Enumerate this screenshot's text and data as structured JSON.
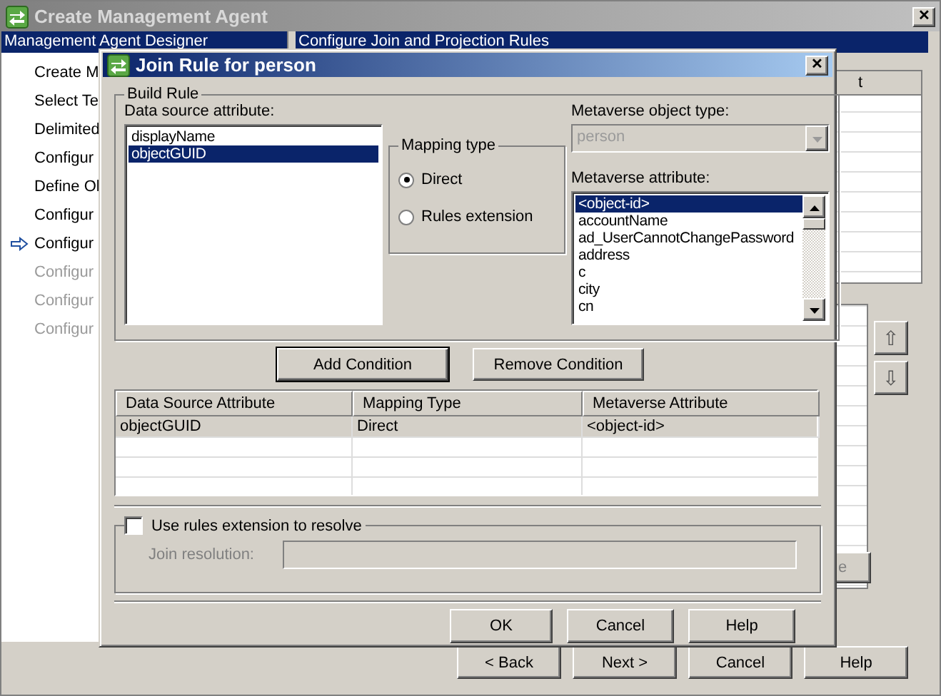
{
  "window": {
    "title": "Create Management Agent",
    "close": "✕"
  },
  "wizard": {
    "sidebar_header": "Management Agent Designer",
    "steps": [
      {
        "label": "Create M",
        "current": false,
        "disabled": false
      },
      {
        "label": "Select Te",
        "current": false,
        "disabled": false
      },
      {
        "label": "Delimited",
        "current": false,
        "disabled": false
      },
      {
        "label": "Configur",
        "current": false,
        "disabled": false
      },
      {
        "label": "Define Ol",
        "current": false,
        "disabled": false
      },
      {
        "label": "Configur",
        "current": false,
        "disabled": false
      },
      {
        "label": "Configur",
        "current": true,
        "disabled": false
      },
      {
        "label": "Configur",
        "current": false,
        "disabled": true
      },
      {
        "label": "Configur",
        "current": false,
        "disabled": true
      },
      {
        "label": "Configur",
        "current": false,
        "disabled": true
      }
    ],
    "page_header": "Configure Join and Projection Rules",
    "grid_column": "t",
    "partial_button": "e",
    "move_buttons": [
      "⇧",
      "⇩"
    ],
    "buttons": [
      "< Back",
      "Next >",
      "Cancel",
      "Help"
    ]
  },
  "dialog": {
    "title": "Join Rule for person",
    "close": "✕",
    "group_title": "Build Rule",
    "data_source_label": "Data source attribute:",
    "data_source_items": [
      {
        "label": "displayName",
        "selected": false
      },
      {
        "label": "objectGUID",
        "selected": true
      }
    ],
    "mapping_type": {
      "title": "Mapping type",
      "options": [
        {
          "label": "Direct",
          "selected": true
        },
        {
          "label": "Rules extension",
          "selected": false
        }
      ]
    },
    "object_type_label": "Metaverse object type:",
    "object_type": {
      "value": "person",
      "disabled": true
    },
    "attribute_label": "Metaverse attribute:",
    "attributes": [
      {
        "label": "<object-id>",
        "selected": true
      },
      {
        "label": "accountName",
        "selected": false
      },
      {
        "label": "ad_UserCannotChangePassword",
        "selected": false
      },
      {
        "label": "address",
        "selected": false
      },
      {
        "label": "c",
        "selected": false
      },
      {
        "label": "city",
        "selected": false
      },
      {
        "label": "cn",
        "selected": false
      }
    ],
    "condition_buttons": [
      "Add Condition",
      "Remove Condition"
    ],
    "table": {
      "columns": [
        "Data Source Attribute",
        "Mapping Type",
        "Metaverse Attribute"
      ],
      "rows": [
        {
          "cells": [
            "objectGUID",
            "Direct",
            "<object-id>"
          ],
          "selected": true
        }
      ]
    },
    "resolve": {
      "label": "Use rules extension to resolve",
      "checked": false
    },
    "join_resolution_label": "Join resolution:",
    "buttons": [
      "OK",
      "Cancel",
      "Help"
    ]
  }
}
